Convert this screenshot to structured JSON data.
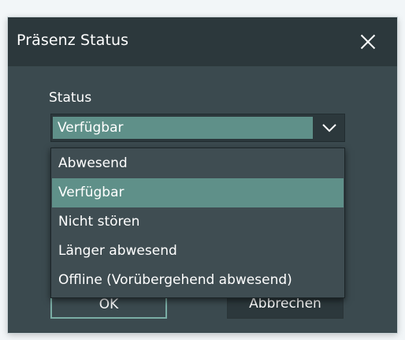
{
  "dialog": {
    "title": "Präsenz Status",
    "close_icon": "close-icon",
    "status_label": "Status",
    "select": {
      "selected_value": "Verfügbar",
      "chevron_icon": "chevron-down-icon"
    },
    "options": [
      {
        "label": "Abwesend",
        "selected": false
      },
      {
        "label": "Verfügbar",
        "selected": true
      },
      {
        "label": "Nicht stören",
        "selected": false
      },
      {
        "label": "Länger abwesend",
        "selected": false
      },
      {
        "label": "Offline (Vorübergehend abwesend)",
        "selected": false
      }
    ],
    "buttons": {
      "ok_label": "OK",
      "cancel_label": "Abbrechen"
    }
  },
  "colors": {
    "dialog_bg": "#3b4a4f",
    "titlebar_bg": "#2c383c",
    "accent": "#5f9089",
    "ok_border": "#7aada5"
  }
}
